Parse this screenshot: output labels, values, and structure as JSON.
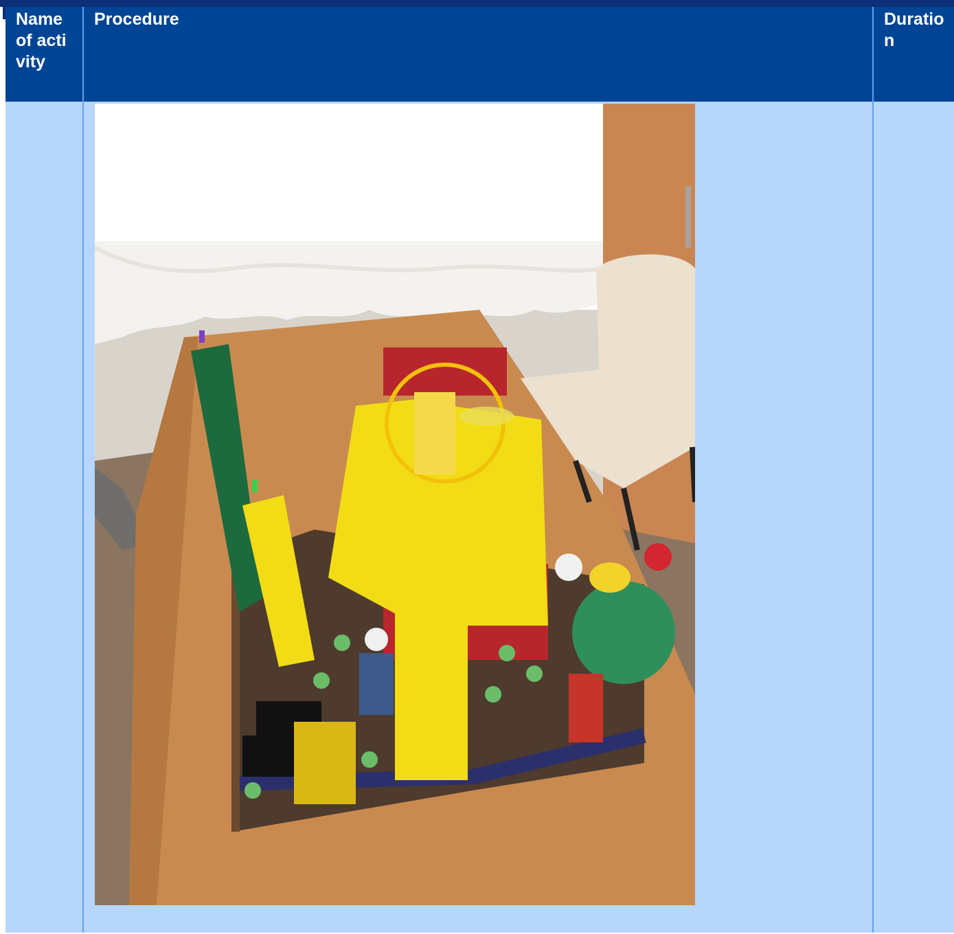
{
  "table": {
    "headers": {
      "name": "Name of activity",
      "procedure": "Procedure",
      "duration": "Duration"
    },
    "row": {
      "name": "",
      "duration": ""
    },
    "photo": {
      "colors": {
        "curtain": "#f4f2ef",
        "wall": "#d9d4cb",
        "wood": "#c98a4f",
        "floor": "#8b7560",
        "chair_seat": "#ece0cf",
        "yellow": "#f2dc16",
        "green_tube": "#1d6a3e",
        "roof_red": "#b8262d",
        "base": "#4e3b2e"
      }
    }
  }
}
